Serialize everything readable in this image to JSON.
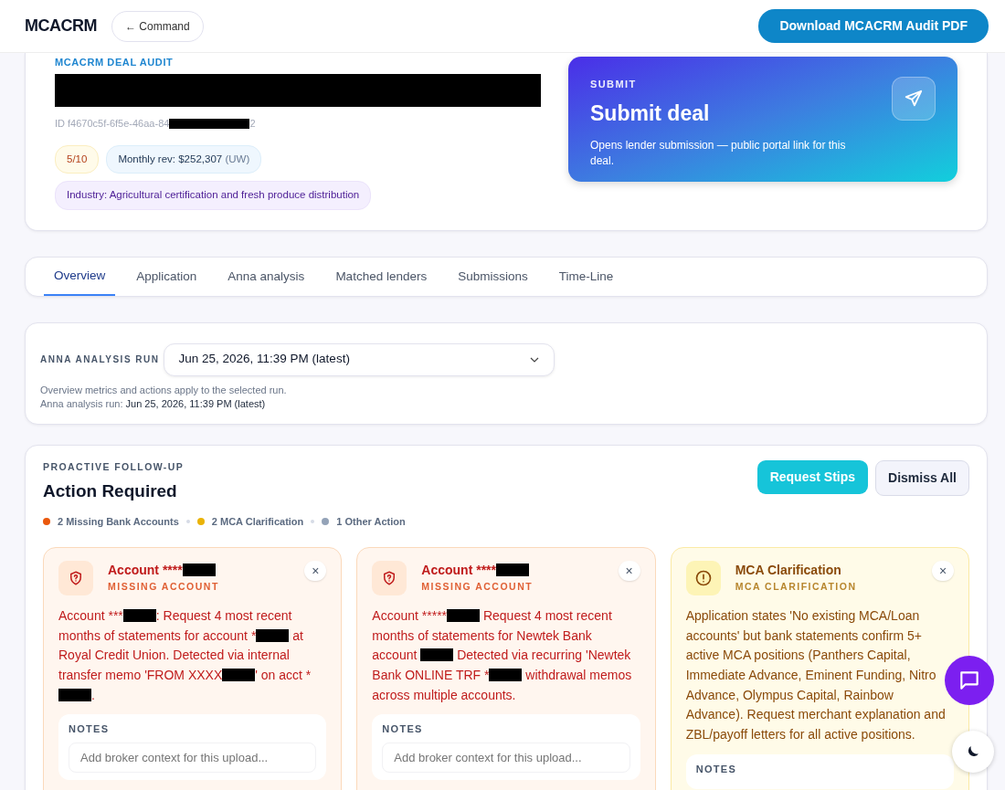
{
  "header": {
    "logo": "MCACRM",
    "back_button": "← Command",
    "download_button": "Download MCACRM Audit PDF"
  },
  "deal": {
    "eyebrow": "MCACRM DEAL AUDIT",
    "title_redacted": true,
    "id_parts": [
      "ID f4670c5f-6f5e-46aa-84",
      {
        "redacted": true
      },
      "2"
    ],
    "score": "5/10",
    "revenue": "Monthly rev: $252,307",
    "revenue_note": "(UW)",
    "industry": "Industry: Agricultural certification and fresh produce distribution"
  },
  "submit": {
    "eyebrow": "SUBMIT",
    "title": "Submit deal",
    "description": "Opens lender submission — public portal link for this deal."
  },
  "tabs": [
    {
      "label": "Overview",
      "selected": true
    },
    {
      "label": "Application",
      "selected": false
    },
    {
      "label": "Anna analysis",
      "selected": false
    },
    {
      "label": "Matched lenders",
      "selected": false
    },
    {
      "label": "Submissions",
      "selected": false
    },
    {
      "label": "Time-Line",
      "selected": false
    }
  ],
  "run": {
    "label": "ANNA ANALYSIS RUN",
    "value": "Jun 25, 2026, 11:39 PM (latest)",
    "note": "Overview metrics and actions apply to the selected run.",
    "current_label": "Anna analysis run:",
    "current_value": "Jun 25, 2026, 11:39 PM (latest)"
  },
  "actions": {
    "eyebrow": "PROACTIVE FOLLOW-UP",
    "title": "Action Required",
    "request_button": "Request Stips",
    "dismiss_button": "Dismiss All",
    "summary": [
      {
        "text": "2 Missing Bank Accounts",
        "color": "#ea580c"
      },
      {
        "text": "2 MCA Clarification",
        "color": "#eab308"
      },
      {
        "text": "1 Other Action",
        "color": "#94a3b8"
      }
    ],
    "cards": [
      {
        "kind": "missing",
        "close": "×",
        "title_parts": [
          "Account ****",
          {
            "redacted": true
          }
        ],
        "subtitle": "MISSING ACCOUNT",
        "body_parts": [
          "Account ***",
          {
            "redacted": true
          },
          ": Request 4 most recent months of statements for account *",
          {
            "redacted": true
          },
          " at Royal Credit Union. Detected via internal transfer memo 'FROM XXXX",
          {
            "redacted": true
          },
          "' on acct *",
          {
            "redacted": true
          },
          "."
        ],
        "notes_label": "NOTES",
        "notes_placeholder": "Add broker context for this upload..."
      },
      {
        "kind": "missing",
        "close": "×",
        "title_parts": [
          "Account ****",
          {
            "redacted": true
          }
        ],
        "subtitle": "MISSING ACCOUNT",
        "body_parts": [
          "Account *****",
          {
            "redacted": true
          },
          " Request 4 most recent months of statements for Newtek Bank account ",
          {
            "redacted": true
          },
          " Detected via recurring 'Newtek Bank ONLINE TRF *",
          {
            "redacted": true
          },
          " withdrawal memos across multiple accounts."
        ],
        "notes_label": "NOTES",
        "notes_placeholder": "Add broker context for this upload..."
      },
      {
        "kind": "clarification",
        "close": "×",
        "title_parts": [
          "MCA Clarification"
        ],
        "subtitle": "MCA CLARIFICATION",
        "body_parts": [
          "Application states 'No existing MCA/Loan accounts' but bank statements confirm 5+ active MCA positions (Panthers Capital, Immediate Advance, Eminent Funding, Nitro Advance, Olympus Capital, Rainbow Advance). Request merchant explanation and ZBL/payoff letters for all active positions."
        ],
        "notes_label": "NOTES"
      }
    ]
  }
}
